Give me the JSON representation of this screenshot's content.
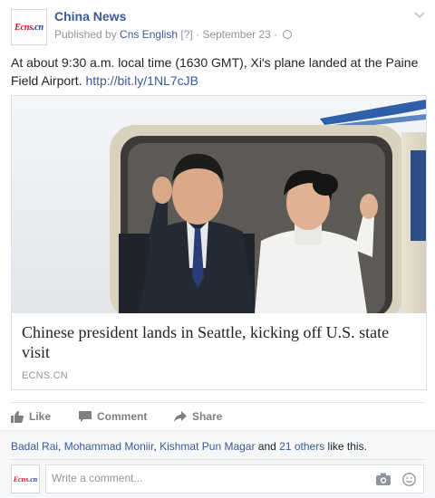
{
  "post": {
    "page_name": "China News",
    "logo_text": "Ecns",
    "logo_dot": ".cn",
    "published_by_prefix": "Published by ",
    "publisher": "Cns English",
    "meta_help": " [?]",
    "meta_sep": " · ",
    "date": "September 23",
    "meta_sep2": " · ",
    "text_main": "At about 9:30 a.m. local time (1630 GMT), Xi's plane landed at the Paine Field Airport. ",
    "text_link": "http://bit.ly/1NL7cJB"
  },
  "card": {
    "title": "Chinese president lands in Seattle, kicking off U.S. state visit",
    "source": "ECNS.CN"
  },
  "actions": {
    "like": "Like",
    "comment": "Comment",
    "share": "Share"
  },
  "likes": {
    "name1": "Badal Rai",
    "sep1": ", ",
    "name2": "Mohammad Moniir",
    "sep2": ", ",
    "name3": "Kishmat Pun Magar",
    "and": " and ",
    "others": "21 others",
    "suffix": " like this."
  },
  "comment": {
    "placeholder": "Write a comment..."
  },
  "colors": {
    "link": "#3b5998",
    "meta": "#90949c",
    "brand_red": "#c8102e"
  },
  "icons": [
    "chevron-down-icon",
    "globe-icon",
    "like-icon",
    "comment-icon",
    "share-icon",
    "camera-icon",
    "emoji-icon"
  ]
}
